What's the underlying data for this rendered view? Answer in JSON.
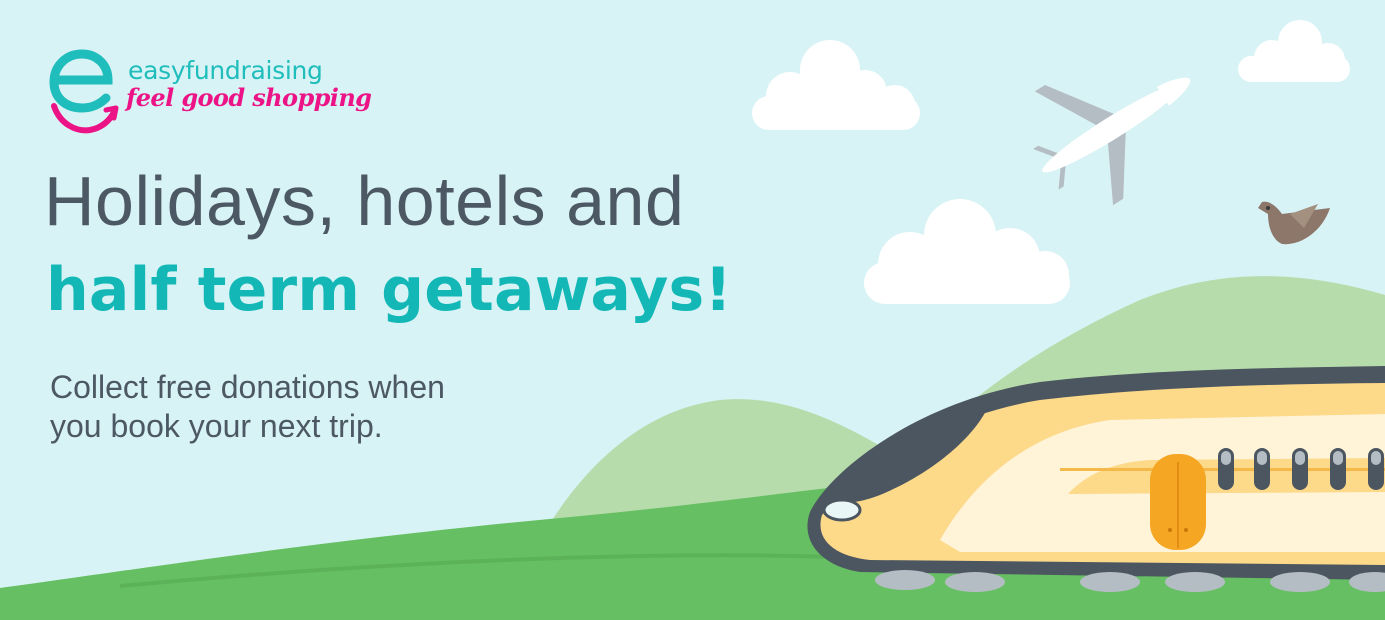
{
  "brand": {
    "name": "easyfundraising",
    "tagline": "feel good shopping"
  },
  "headline": {
    "line1": "Holidays, hotels and",
    "line2": "half term getaways!"
  },
  "subtext": {
    "line1": "Collect free donations when",
    "line2": "you book your next trip."
  },
  "colors": {
    "sky": "#d8f3f5",
    "brand_teal": "#13b7b6",
    "brand_pink": "#ec1387",
    "text_grey": "#4c5863",
    "hill_light": "#b7dcac",
    "grass": "#67bf63",
    "train_yellow": "#fdd98a",
    "train_cream": "#fff3d8",
    "train_dark": "#4c5660",
    "door_orange": "#f5a623"
  },
  "icons": [
    "easyfundraising-logo-icon",
    "cloud-icon",
    "airplane-icon",
    "bird-icon",
    "train-icon"
  ]
}
